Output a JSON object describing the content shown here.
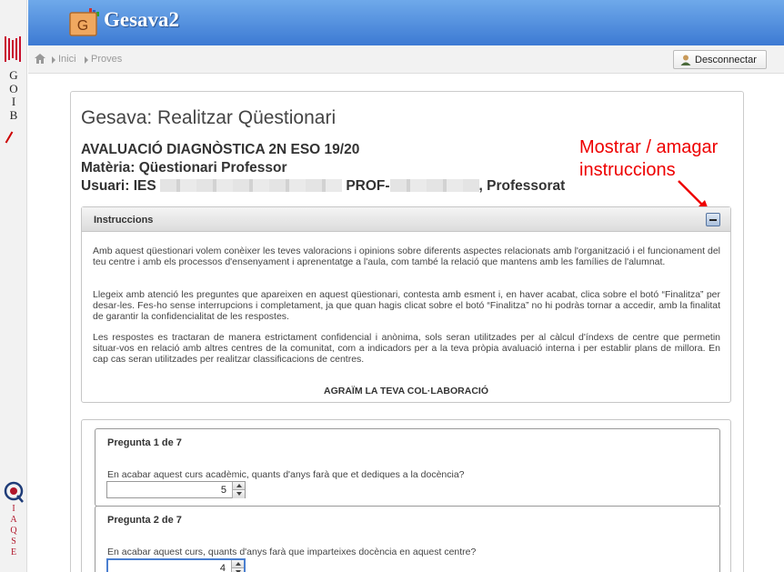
{
  "sidebar": {
    "goib_letters": [
      "G",
      "O",
      "I",
      "B"
    ],
    "iaqse_letters": [
      "I",
      "A",
      "Q",
      "S",
      "E"
    ]
  },
  "header": {
    "app_title": "Gesava2",
    "logo_letter": "G"
  },
  "breadcrumb": {
    "items": [
      "Inici",
      "Proves"
    ],
    "logout_label": "Desconnectar"
  },
  "page": {
    "title": "Gesava: Realitzar Qüestionari",
    "survey_name": "AVALUACIÓ DIAGNÒSTICA 2N ESO 19/20",
    "subject": "Matèria: Qüestionari Professor",
    "user_prefix": "Usuari: IES",
    "user_mid": "PROF-",
    "user_suffix": ", Professorat"
  },
  "annotation": {
    "line1": "Mostrar / amagar",
    "line2": "instruccions"
  },
  "instructions": {
    "title": "Instruccions",
    "paragraphs": [
      "Amb aquest qüestionari volem conèixer les teves valoracions i opinions sobre diferents aspectes relacionats amb l'organització i el funcionament del teu centre i amb els processos d'ensenyament i aprenentatge a l'aula, com també la relació que mantens amb les famílies de l'alumnat.",
      "Llegeix amb atenció les preguntes que apareixen en aquest qüestionari, contesta amb esment i, en haver acabat, clica sobre el botó “Finalitza” per desar-les. Fes-ho sense interrupcions i completament, ja que quan hagis clicat sobre el botó “Finalitza” no hi podràs tornar a accedir, amb la finalitat de garantir la confidencialitat de les respostes.",
      "Les respostes es tractaran de manera estrictament confidencial i anònima, sols seran utilitzades per al càlcul d'índexs de centre que permetin situar-vos en relació amb altres centres de la comunitat, com a indicadors per a la teva pròpia avaluació interna i per establir plans de millora. En cap cas seran utilitzades per realitzar classificacions de centres."
    ],
    "thanks": "AGRAÏM LA TEVA COL·LABORACIÓ"
  },
  "questions": [
    {
      "title": "Pregunta 1 de 7",
      "text": "En acabar aquest curs acadèmic, quants d'anys farà que et dediques a la docència?",
      "value": "5"
    },
    {
      "title": "Pregunta 2 de 7",
      "text": "En acabar aquest curs, quants d'anys farà que imparteixes docència en aquest centre?",
      "value": "4"
    }
  ],
  "colors": {
    "header_top": "#6fa9ea",
    "header_bottom": "#3d7ad3",
    "annotation": "#e00000",
    "iaqse": "#b0162a"
  }
}
